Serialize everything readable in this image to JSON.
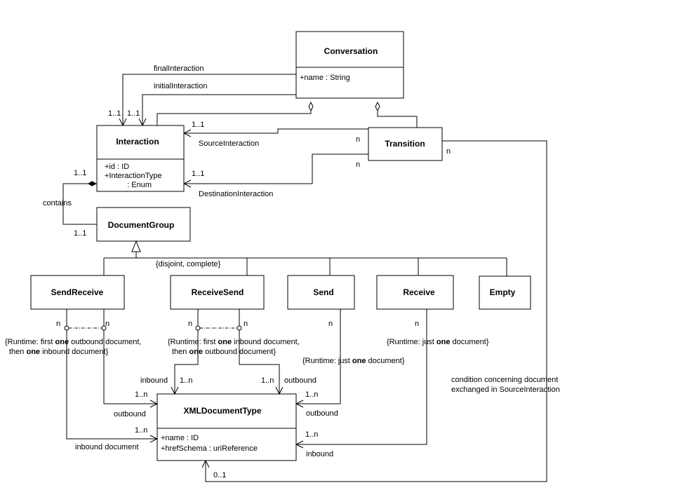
{
  "classes": {
    "conversation": {
      "name": "Conversation",
      "attributes": [
        "+name : String"
      ]
    },
    "interaction": {
      "name": "Interaction",
      "attributes": [
        "+id : ID",
        "+InteractionType",
        "    : Enum"
      ]
    },
    "transition": {
      "name": "Transition"
    },
    "document_group": {
      "name": "DocumentGroup"
    },
    "send_receive": {
      "name": "SendReceive"
    },
    "receive_send": {
      "name": "ReceiveSend"
    },
    "send": {
      "name": "Send"
    },
    "receive": {
      "name": "Receive"
    },
    "empty": {
      "name": "Empty"
    },
    "xml_document_type": {
      "name": "XMLDocumentType",
      "attributes": [
        "+name : ID",
        "+hrefSchema : uriReference"
      ]
    }
  },
  "labels": {
    "final_interaction": "finalInteraction",
    "initial_interaction": "initialInteraction",
    "mult_final": "1..1",
    "mult_initial": "1..1",
    "mult_source_top": "1..1",
    "source_interaction": "SourceInteraction",
    "mult_dest": "1..1",
    "destination_interaction": "DestinationInteraction",
    "transition_n_source": "n",
    "transition_n_dest": "n",
    "transition_n_right": "n",
    "mult_contains_top": "1..1",
    "contains": "contains",
    "mult_contains_bottom": "1..1",
    "generalization_constraint": "{disjoint, complete}",
    "sr_n_left": "n",
    "sr_n_right": "n",
    "rs_n_left": "n",
    "rs_n_right": "n",
    "send_n": "n",
    "receive_n": "n",
    "sr_constraint_line1_a": "{Runtime: first ",
    "sr_constraint_line1_b": "one",
    "sr_constraint_line1_c": " outbound document,",
    "sr_constraint_line2_a": "then ",
    "sr_constraint_line2_b": "one",
    "sr_constraint_line2_c": " inbound document}",
    "rs_constraint_line1_a": "{Runtime: first ",
    "rs_constraint_line1_b": "one",
    "rs_constraint_line1_c": " inbound document,",
    "rs_constraint_line2_a": "then ",
    "rs_constraint_line2_b": "one",
    "rs_constraint_line2_c": " outbound document}",
    "send_constraint_a": "{Runtime: just ",
    "send_constraint_b": "one",
    "send_constraint_c": " document}",
    "receive_constraint_a": "{Runtime: just ",
    "receive_constraint_b": "one",
    "receive_constraint_c": " document}",
    "rs_inbound": "inbound",
    "rs_inbound_mult": "1..n",
    "rs_outbound_mult": "1..n",
    "rs_outbound": "outbound",
    "sr_outbound_mult": "1..n",
    "sr_outbound": "outbound",
    "sr_inbound_mult": "1..n",
    "sr_inbound": "inbound document",
    "send_outbound_mult": "1..n",
    "send_outbound": "outbound",
    "receive_inbound_mult": "1..n",
    "receive_inbound": "inbound",
    "condition_mult": "0..1",
    "condition_note_line1": "condition concerning document",
    "condition_note_line2": "exchanged in SourceInteraction"
  }
}
